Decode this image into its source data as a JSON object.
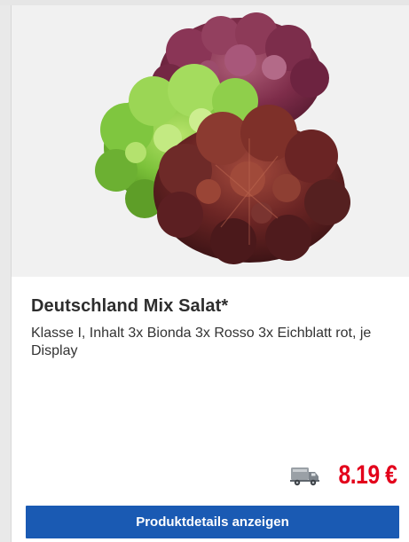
{
  "product": {
    "title": "Deutschland Mix Salat*",
    "description": "Klasse I, Inhalt 3x Bionda 3x Rosso 3x Eichblatt rot, je Display",
    "price": "8.19 €",
    "image_icon": "lettuce-mix-image",
    "delivery_icon": "delivery-truck-icon"
  },
  "actions": {
    "details_label": "Produktdetails anzeigen"
  },
  "colors": {
    "price": "#e3001b",
    "button": "#1a5ab3",
    "image_background": "#f1f1f1"
  }
}
